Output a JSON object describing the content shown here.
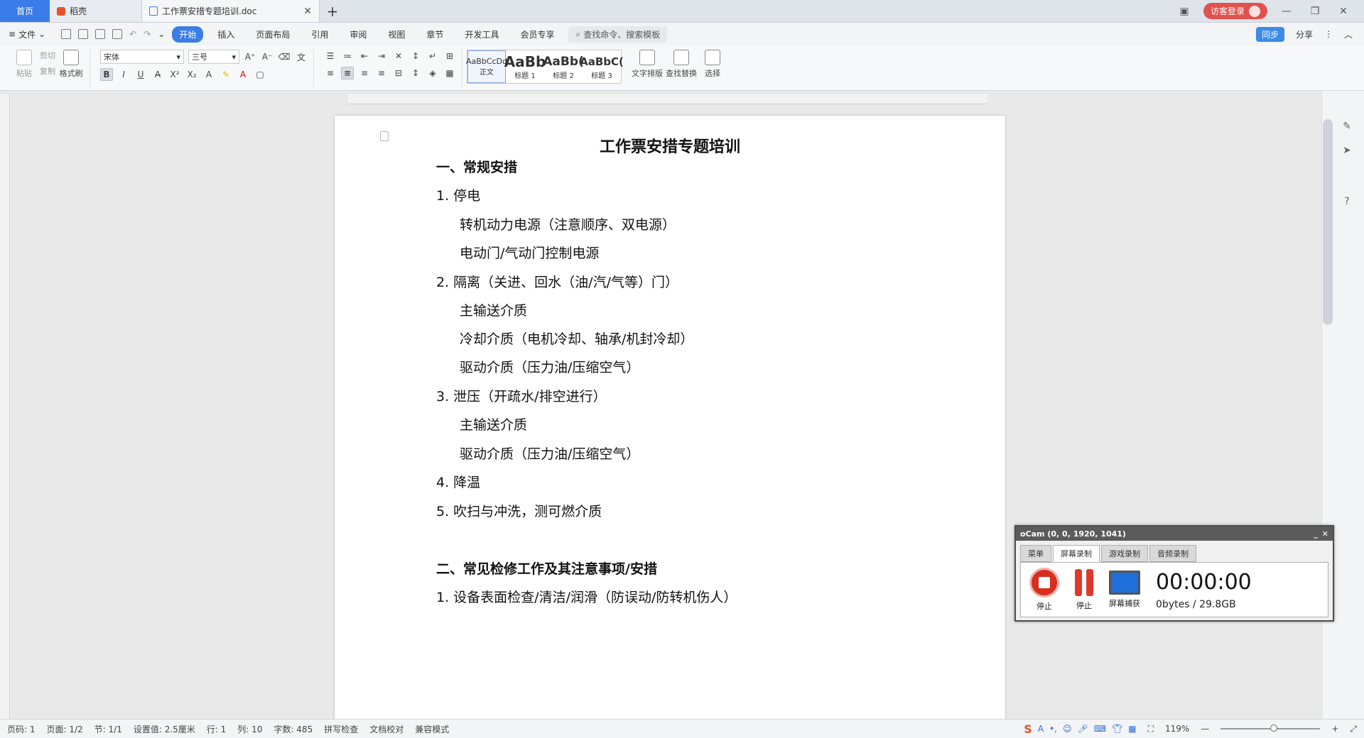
{
  "titlebar": {
    "home_tab": "首页",
    "docer_tab": "稻壳",
    "doc_tab": "工作票安措专题培训.doc",
    "login": "访客登录"
  },
  "menubar": {
    "file": "文件",
    "tabs": [
      {
        "label": "开始",
        "active": true
      },
      {
        "label": "插入"
      },
      {
        "label": "页面布局"
      },
      {
        "label": "引用"
      },
      {
        "label": "审阅"
      },
      {
        "label": "视图"
      },
      {
        "label": "章节"
      },
      {
        "label": "开发工具"
      },
      {
        "label": "会员专享"
      }
    ],
    "search_placeholder": "查找命令、搜索模板",
    "share": "分享",
    "cloud_badge": "同步"
  },
  "ribbon": {
    "paste": "粘贴",
    "cut": "剪切",
    "copy": "复制",
    "format_painter": "格式刷",
    "font_name": "宋体",
    "font_size": "三号",
    "styles": [
      {
        "preview": "AaBbCcDd",
        "label": "正文"
      },
      {
        "preview": "AaBb",
        "label": "标题 1"
      },
      {
        "preview": "AaBb(",
        "label": "标题 2"
      },
      {
        "preview": "AaBbC(",
        "label": "标题 3"
      }
    ],
    "text_layout": "文字排版",
    "find_replace": "查找替换",
    "select": "选择"
  },
  "document": {
    "title": "工作票安措专题培训",
    "lines": [
      {
        "text": "一、常规安措",
        "kind": "sec"
      },
      {
        "text": "1. 停电",
        "kind": "l1"
      },
      {
        "text": "转机动力电源（注意顺序、双电源）",
        "kind": "l2"
      },
      {
        "text": "电动门/气动门控制电源",
        "kind": "l2"
      },
      {
        "text": "2. 隔离（关进、回水（油/汽/气等）门）",
        "kind": "l1"
      },
      {
        "text": "主输送介质",
        "kind": "l2"
      },
      {
        "text": "冷却介质（电机冷却、轴承/机封冷却）",
        "kind": "l2"
      },
      {
        "text": "驱动介质（压力油/压缩空气）",
        "kind": "l2"
      },
      {
        "text": "3. 泄压（开疏水/排空进行）",
        "kind": "l1"
      },
      {
        "text": "主输送介质",
        "kind": "l2"
      },
      {
        "text": "驱动介质（压力油/压缩空气）",
        "kind": "l2"
      },
      {
        "text": "4. 降温",
        "kind": "l1"
      },
      {
        "text": "5. 吹扫与冲洗，测可燃介质",
        "kind": "l1"
      },
      {
        "text": "二、常见检修工作及其注意事项/安措",
        "kind": "sec"
      },
      {
        "text": "1. 设备表面检查/清洁/润滑（防误动/防转机伤人）",
        "kind": "l1"
      }
    ]
  },
  "ocam": {
    "title": "oCam (0, 0, 1920, 1041)",
    "tabs": [
      "菜单",
      "屏幕录制",
      "游戏录制",
      "音频录制"
    ],
    "stop_label": "停止",
    "pause_label": "停止",
    "capture_label": "屏幕捕获",
    "timer": "00:00:00",
    "size": "0bytes / 29.8GB"
  },
  "statusbar": {
    "page_num": "页码: 1",
    "pages": "页面: 1/2",
    "section": "节: 1/1",
    "setting": "设置值: 2.5厘米",
    "row": "行: 1",
    "col": "列: 10",
    "words": "字数: 485",
    "spell": "拼写检查",
    "proof": "文档校对",
    "compat": "兼容模式",
    "zoom": "119%"
  }
}
